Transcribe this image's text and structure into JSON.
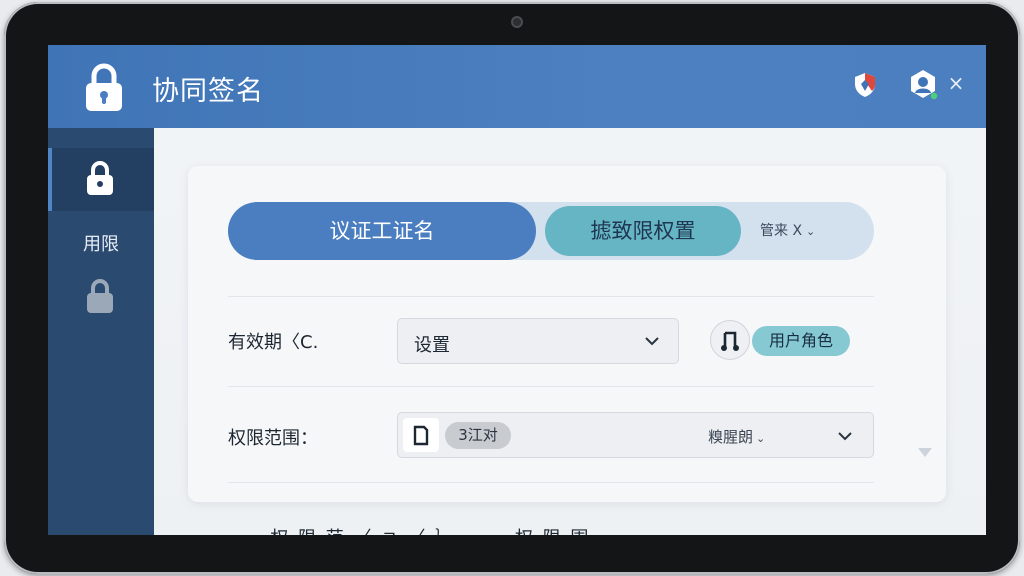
{
  "colors": {
    "header": "#4a7ec0",
    "sidebar": "#2b4a6f",
    "tab_active": "#4a7ec0",
    "tab_secondary": "#66b5c5",
    "tab_bar": "#d3e0ee",
    "role_pill": "#86c9d3"
  },
  "header": {
    "title": "协同签名",
    "icons": [
      "lock-icon",
      "shield-icon",
      "user-settings-icon",
      "close-icon"
    ],
    "close_glyph": "×"
  },
  "sidebar": {
    "items": [
      {
        "icon": "lock-icon",
        "active": true
      },
      {
        "label": "用限"
      },
      {
        "icon": "lock-icon",
        "active": false
      }
    ]
  },
  "tabs": [
    {
      "label": "议证工证名",
      "active": true
    },
    {
      "label": "摅致限权置",
      "active": false
    },
    {
      "label": "管来 X",
      "chevron": "⌄"
    }
  ],
  "form": {
    "row1": {
      "label": "有效期〈C.",
      "select_value": "设置",
      "role_icon": "user-icon",
      "role_label": "用户角色"
    },
    "row2": {
      "label": "权限范围：",
      "doc_icon": "document-icon",
      "count_badge": "3江对",
      "mid_label": "糗腥朗",
      "mid_chevron": "⌄"
    }
  },
  "footer_cutoff_text": "ㅡ 权 限 范 〈 ㄱ 〈 ｝ 一 ㅤ 权 限 围"
}
